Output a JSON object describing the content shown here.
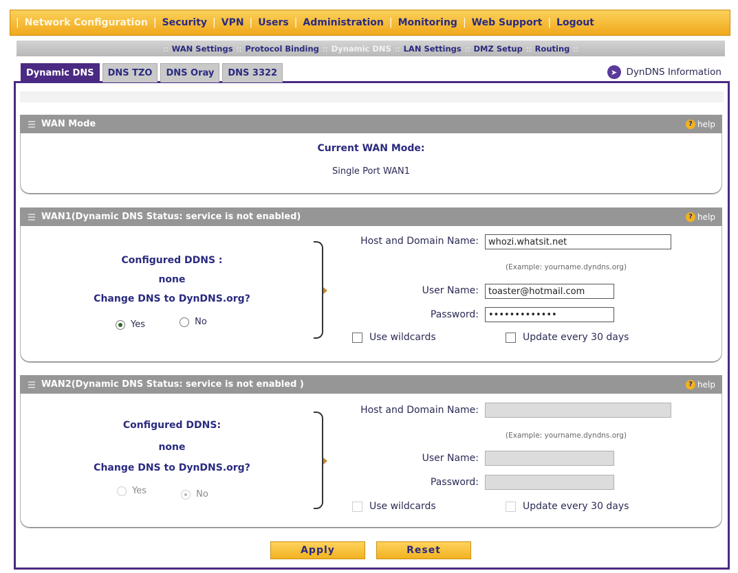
{
  "top_nav": [
    "Network Configuration",
    "Security",
    "VPN",
    "Users",
    "Administration",
    "Monitoring",
    "Web Support",
    "Logout"
  ],
  "sub_nav": [
    "WAN Settings",
    "Protocol Binding",
    "Dynamic DNS",
    "LAN Settings",
    "DMZ Setup",
    "Routing"
  ],
  "tabs": [
    "Dynamic DNS",
    "DNS TZO",
    "DNS Oray",
    "DNS 3322"
  ],
  "dyndns_info": "DynDNS Information",
  "help": "help",
  "wan_mode": {
    "title": "WAN Mode",
    "current_label": "Current WAN Mode:",
    "current_value": "Single Port WAN1"
  },
  "wan1": {
    "title": "WAN1(Dynamic DNS Status: service is not enabled)",
    "configured_label": "Configured DDNS :",
    "configured_value": "none",
    "change_label": "Change DNS to DynDNS.org?",
    "yes": "Yes",
    "no": "No",
    "host_label": "Host and Domain Name:",
    "host_value": "whozi.whatsit.net",
    "example": "(Example: yourname.dyndns.org)",
    "user_label": "User Name:",
    "user_value": "toaster@hotmail.com",
    "password_label": "Password:",
    "password_value": "passwordpass1",
    "wildcards": "Use wildcards",
    "update": "Update every 30 days"
  },
  "wan2": {
    "title": "WAN2(Dynamic DNS Status: service is not enabled )",
    "configured_label": "Configured DDNS:",
    "configured_value": "none",
    "change_label": "Change DNS to DynDNS.org?",
    "yes": "Yes",
    "no": "No",
    "host_label": "Host and Domain Name:",
    "example": "(Example: yourname.dyndns.org)",
    "user_label": "User Name:",
    "password_label": "Password:",
    "wildcards": "Use wildcards",
    "update": "Update every 30 days"
  },
  "buttons": {
    "apply": "Apply",
    "reset": "Reset"
  }
}
